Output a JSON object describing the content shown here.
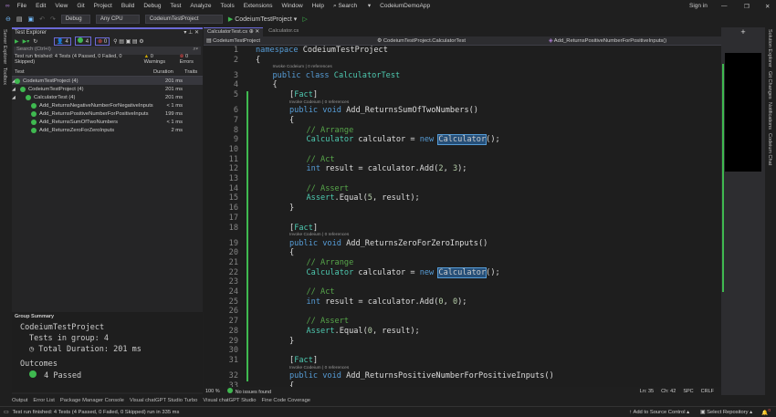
{
  "menu": [
    "File",
    "Edit",
    "View",
    "Git",
    "Project",
    "Build",
    "Debug",
    "Test",
    "Analyze",
    "Tools",
    "Extensions",
    "Window",
    "Help"
  ],
  "search": "Search",
  "app_title": "CodeiumDemoApp",
  "sign_in": "Sign in",
  "toolbar": {
    "config": "Debug",
    "platform": "Any CPU",
    "startup": "CodeiumTestProject",
    "run": "CodeiumTestProject"
  },
  "left_strip": [
    "Server Explorer",
    "Toolbox"
  ],
  "right_strip": [
    "Solution Explorer",
    "Git Changes",
    "Notifications",
    "Codeium Chat"
  ],
  "test_explorer": {
    "title": "Test Explorer",
    "counts": {
      "total": "4",
      "passed": "4",
      "failed": "0"
    },
    "search_placeholder": "Search (Ctrl+I)",
    "summary": "Test run finished: 4 Tests (4 Passed, 0 Failed, 0 Skipped)",
    "warnings": "0 Warnings",
    "errors": "0 Errors",
    "columns": {
      "test": "Test",
      "duration": "Duration",
      "traits": "Traits"
    },
    "rows": [
      {
        "name": "CodeiumTestProject (4)",
        "duration": "201 ms",
        "level": 0
      },
      {
        "name": "CodeiumTestProject (4)",
        "duration": "201 ms",
        "level": 1
      },
      {
        "name": "CalculatorTest (4)",
        "duration": "201 ms",
        "level": 2
      },
      {
        "name": "Add_ReturnsNegativeNumberForNegativeInputs",
        "duration": "< 1 ms",
        "level": 3
      },
      {
        "name": "Add_ReturnsPositiveNumberForPositiveInputs",
        "duration": "199 ms",
        "level": 3
      },
      {
        "name": "Add_ReturnsSumOfTwoNumbers",
        "duration": "< 1 ms",
        "level": 3
      },
      {
        "name": "Add_ReturnsZeroForZeroInputs",
        "duration": "2 ms",
        "level": 3
      }
    ],
    "group": {
      "header": "Group Summary",
      "project": "CodeiumTestProject",
      "tests": "Tests in group: 4",
      "duration": "Total Duration: 201 ms",
      "outcomes": "Outcomes",
      "passed": "4 Passed"
    }
  },
  "editor": {
    "tabs": [
      "CalculatorTest.cs",
      "Calculator.cs"
    ],
    "nav": {
      "project": "CodeiumTestProject",
      "class": "CodeiumTestProject.CalculatorTest",
      "member": "Add_ReturnsPositiveNumberForPositiveInputs()"
    },
    "lens": "Invoke Codeium | 0 references",
    "lines": [
      {
        "n": "1",
        "t": [
          [
            "kw",
            "namespace "
          ],
          [
            "tx",
            "CodeiumTestProject"
          ]
        ]
      },
      {
        "n": "2",
        "t": [
          [
            "tx",
            "{"
          ]
        ]
      },
      {
        "n": "3",
        "lens": true,
        "i": 1,
        "t": [
          [
            "kw",
            "public class "
          ],
          [
            "ty",
            "CalculatorTest"
          ]
        ]
      },
      {
        "n": "4",
        "i": 1,
        "t": [
          [
            "tx",
            "{"
          ]
        ]
      },
      {
        "n": "5",
        "i": 2,
        "t": [
          [
            "tx",
            "["
          ],
          [
            "ty",
            "Fact"
          ],
          [
            "tx",
            "]"
          ]
        ]
      },
      {
        "n": "6",
        "lens": true,
        "i": 2,
        "t": [
          [
            "kw",
            "public void "
          ],
          [
            "tx",
            "Add_ReturnsSumOfTwoNumbers()"
          ]
        ]
      },
      {
        "n": "7",
        "i": 2,
        "t": [
          [
            "tx",
            "{"
          ]
        ]
      },
      {
        "n": "8",
        "i": 3,
        "t": [
          [
            "cm",
            "// Arrange"
          ]
        ]
      },
      {
        "n": "9",
        "i": 3,
        "t": [
          [
            "ty",
            "Calculator "
          ],
          [
            "tx",
            "calculator = "
          ],
          [
            "kw",
            "new "
          ],
          [
            "hl",
            "Calculator"
          ],
          [
            "tx",
            "();"
          ]
        ]
      },
      {
        "n": "10",
        "t": []
      },
      {
        "n": "11",
        "i": 3,
        "t": [
          [
            "cm",
            "// Act"
          ]
        ]
      },
      {
        "n": "12",
        "i": 3,
        "t": [
          [
            "kw",
            "int "
          ],
          [
            "tx",
            "result = calculator.Add("
          ],
          [
            "nm",
            "2"
          ],
          [
            "tx",
            ", "
          ],
          [
            "nm",
            "3"
          ],
          [
            "tx",
            ");"
          ]
        ]
      },
      {
        "n": "13",
        "t": []
      },
      {
        "n": "14",
        "i": 3,
        "t": [
          [
            "cm",
            "// Assert"
          ]
        ]
      },
      {
        "n": "15",
        "i": 3,
        "t": [
          [
            "ty",
            "Assert"
          ],
          [
            "tx",
            ".Equal("
          ],
          [
            "nm",
            "5"
          ],
          [
            "tx",
            ", result);"
          ]
        ]
      },
      {
        "n": "16",
        "i": 2,
        "t": [
          [
            "tx",
            "}"
          ]
        ]
      },
      {
        "n": "17",
        "t": []
      },
      {
        "n": "18",
        "i": 2,
        "t": [
          [
            "tx",
            "["
          ],
          [
            "ty",
            "Fact"
          ],
          [
            "tx",
            "]"
          ]
        ]
      },
      {
        "n": "19",
        "lens": true,
        "i": 2,
        "t": [
          [
            "kw",
            "public void "
          ],
          [
            "tx",
            "Add_ReturnsZeroForZeroInputs()"
          ]
        ]
      },
      {
        "n": "20",
        "i": 2,
        "t": [
          [
            "tx",
            "{"
          ]
        ]
      },
      {
        "n": "21",
        "i": 3,
        "t": [
          [
            "cm",
            "// Arrange"
          ]
        ]
      },
      {
        "n": "22",
        "i": 3,
        "t": [
          [
            "ty",
            "Calculator "
          ],
          [
            "tx",
            "calculator = "
          ],
          [
            "kw",
            "new "
          ],
          [
            "hl",
            "Calculator"
          ],
          [
            "tx",
            "();"
          ]
        ]
      },
      {
        "n": "23",
        "t": []
      },
      {
        "n": "24",
        "i": 3,
        "t": [
          [
            "cm",
            "// Act"
          ]
        ]
      },
      {
        "n": "25",
        "i": 3,
        "t": [
          [
            "kw",
            "int "
          ],
          [
            "tx",
            "result = calculator.Add("
          ],
          [
            "nm",
            "0"
          ],
          [
            "tx",
            ", "
          ],
          [
            "nm",
            "0"
          ],
          [
            "tx",
            ");"
          ]
        ]
      },
      {
        "n": "26",
        "t": []
      },
      {
        "n": "27",
        "i": 3,
        "t": [
          [
            "cm",
            "// Assert"
          ]
        ]
      },
      {
        "n": "28",
        "i": 3,
        "t": [
          [
            "ty",
            "Assert"
          ],
          [
            "tx",
            ".Equal("
          ],
          [
            "nm",
            "0"
          ],
          [
            "tx",
            ", result);"
          ]
        ]
      },
      {
        "n": "29",
        "i": 2,
        "t": [
          [
            "tx",
            "}"
          ]
        ]
      },
      {
        "n": "30",
        "t": []
      },
      {
        "n": "31",
        "i": 2,
        "t": [
          [
            "tx",
            "["
          ],
          [
            "ty",
            "Fact"
          ],
          [
            "tx",
            "]"
          ]
        ]
      },
      {
        "n": "32",
        "lens": true,
        "i": 2,
        "t": [
          [
            "kw",
            "public void "
          ],
          [
            "tx",
            "Add_ReturnsPositiveNumberForPositiveInputs()"
          ]
        ]
      },
      {
        "n": "33",
        "i": 2,
        "t": [
          [
            "tx",
            "{"
          ]
        ]
      }
    ],
    "status": {
      "zoom": "100 %",
      "issues": "No issues found",
      "ln": "Ln: 35",
      "ch": "Ch: 42",
      "spc": "SPC",
      "crlf": "CRLF"
    }
  },
  "bottom_tabs": [
    "Output",
    "Error List",
    "Package Manager Console",
    "Visual chatGPT Studio Turbo",
    "Visual chatGPT Studio",
    "Fine Code Coverage"
  ],
  "statusbar": {
    "message": "Test run finished: 4 Tests (4 Passed, 0 Failed, 0 Skipped) run in 335 ms",
    "source_control": "Add to Source Control",
    "repo": "Select Repository",
    "notifications": "0"
  }
}
